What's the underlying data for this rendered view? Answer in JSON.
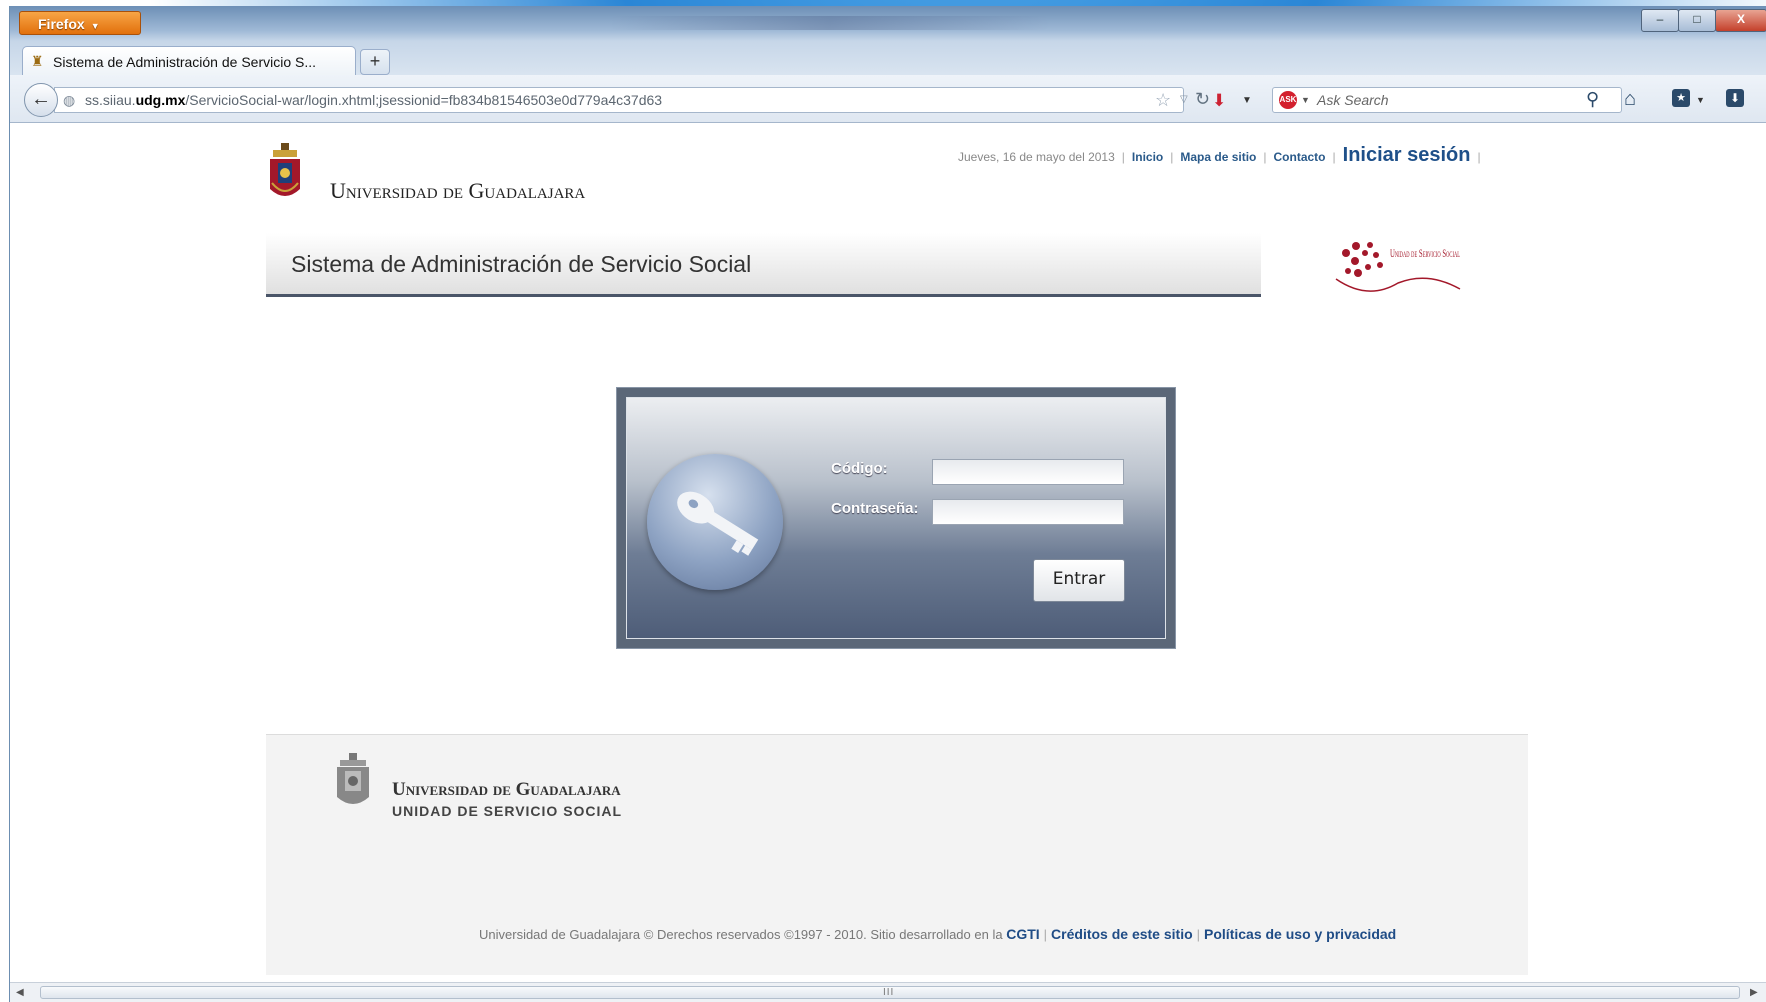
{
  "browser": {
    "menu_button": "Firefox",
    "tab_title": "Sistema de Administración de Servicio S...",
    "new_tab": "+",
    "url_host_prefix": "ss.siiau.",
    "url_host_domain": "udg.mx",
    "url_path": "/ServicioSocial-war/login.xhtml;jsessionid=fb834b81546503e0d779a4c37d63",
    "search_placeholder": "Ask Search",
    "window_controls": {
      "minimize": "–",
      "maximize": "□",
      "close": "X"
    }
  },
  "header": {
    "logo_text": "Universidad de Guadalajara",
    "date": "Jueves, 16 de mayo del 2013",
    "nav": [
      "Inicio",
      "Mapa de sitio",
      "Contacto"
    ],
    "login_link": "Iniciar sesión",
    "system_title": "Sistema de Administración de Servicio Social",
    "unit_logo_text": "Unidad de Servicio Social"
  },
  "login": {
    "codigo_label": "Código:",
    "password_label": "Contraseña:",
    "codigo_value": "",
    "password_value": "",
    "submit_label": "Entrar"
  },
  "footer": {
    "name": "Universidad de Guadalajara",
    "unit": "UNIDAD DE SERVICIO SOCIAL",
    "copyright": "Universidad de Guadalajara © Derechos reservados ©1997 - 2010. Sitio desarrollado en la",
    "cgti": "CGTI",
    "credits": "Créditos de este sitio",
    "policies": "Políticas de uso y privacidad"
  },
  "scrollbar": {
    "grip": "III"
  },
  "colors": {
    "accent_orange": "#e2700c",
    "link_blue": "#1f5089",
    "panel_dark": "#4e5d78",
    "brand_red": "#a3182a"
  }
}
